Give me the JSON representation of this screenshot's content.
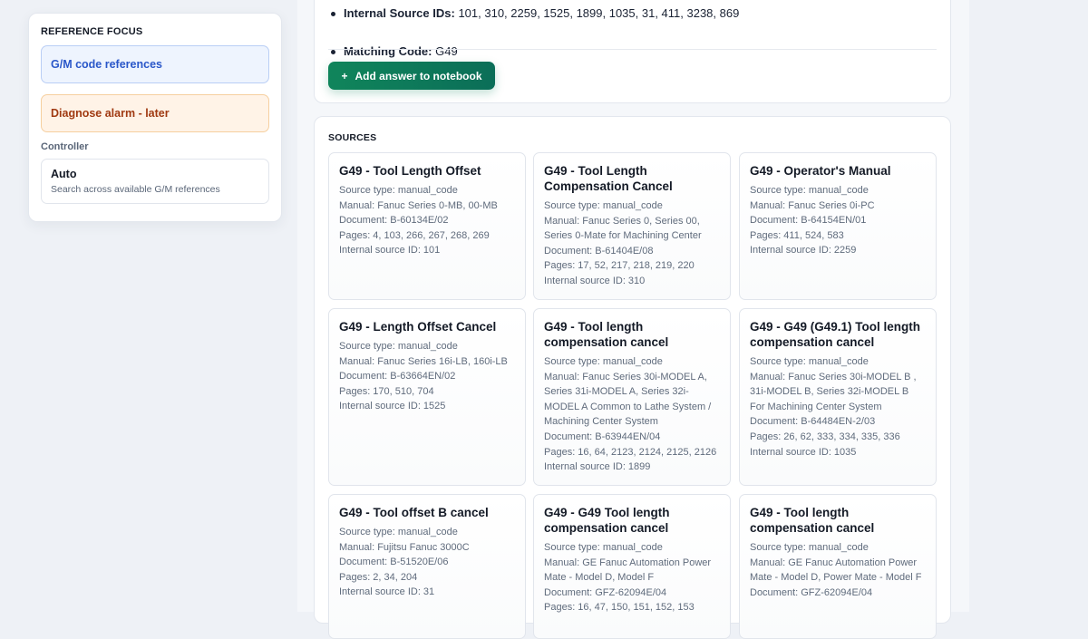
{
  "sidebar": {
    "title": "REFERENCE FOCUS",
    "options": [
      {
        "label": "G/M code references"
      },
      {
        "label": "Diagnose alarm - later"
      }
    ],
    "controller_label": "Controller",
    "controller": {
      "value": "Auto",
      "hint": "Search across available G/M references"
    }
  },
  "answer": {
    "items": [
      {
        "key": "Internal Source IDs",
        "value": "101, 310, 2259, 1525, 1899, 1035, 31, 411, 3238, 869"
      },
      {
        "key": "Matching Code",
        "value": "G49"
      }
    ],
    "add_button": "Add answer to notebook",
    "add_icon": "+"
  },
  "sources": {
    "title": "SOURCES",
    "items": [
      {
        "title": "G49 - Tool Length Offset",
        "lines": [
          "Source type: manual_code",
          "Manual: Fanuc Series 0-MB, 00-MB",
          "Document: B-60134E/02",
          "Pages: 4, 103, 266, 267, 268, 269",
          "Internal source ID: 101"
        ]
      },
      {
        "title": "G49 - Tool Length Compensation Cancel",
        "lines": [
          "Source type: manual_code",
          "Manual: Fanuc Series 0, Series 00, Series 0-Mate for Machining Center",
          "Document: B-61404E/08",
          "Pages: 17, 52, 217, 218, 219, 220",
          "Internal source ID: 310"
        ]
      },
      {
        "title": "G49 - Operator's Manual",
        "lines": [
          "Source type: manual_code",
          "Manual: Fanuc Series 0i-PC",
          "Document: B-64154EN/01",
          "Pages: 411, 524, 583",
          "Internal source ID: 2259"
        ]
      },
      {
        "title": "G49 - Length Offset Cancel",
        "lines": [
          "Source type: manual_code",
          "Manual: Fanuc Series 16i-LB, 160i-LB",
          "Document: B-63664EN/02",
          "Pages: 170, 510, 704",
          "Internal source ID: 1525"
        ]
      },
      {
        "title": "G49 - Tool length compensation cancel",
        "lines": [
          "Source type: manual_code",
          "Manual: Fanuc Series 30i-MODEL A, Series 31i-MODEL A, Series 32i-MODEL A Common to Lathe System / Machining Center System",
          "Document: B-63944EN/04",
          "Pages: 16, 64, 2123, 2124, 2125, 2126",
          "Internal source ID: 1899"
        ]
      },
      {
        "title": "G49 - G49 (G49.1) Tool length compensation cancel",
        "lines": [
          "Source type: manual_code",
          "Manual: Fanuc Series 30i-MODEL B , 31i-MODEL B, Series 32i-MODEL B For Machining Center System",
          "Document: B-64484EN-2/03",
          "Pages: 26, 62, 333, 334, 335, 336",
          "Internal source ID: 1035"
        ]
      },
      {
        "title": "G49 - Tool offset B cancel",
        "lines": [
          "Source type: manual_code",
          "Manual: Fujitsu Fanuc 3000C",
          "Document: B-51520E/06",
          "Pages: 2, 34, 204",
          "Internal source ID: 31"
        ]
      },
      {
        "title": "G49 - G49 Tool length compensation cancel",
        "lines": [
          "Source type: manual_code",
          "Manual: GE Fanuc Automation Power Mate - Model D, Model F",
          "Document: GFZ-62094E/04",
          "Pages: 16, 47, 150, 151, 152, 153"
        ]
      },
      {
        "title": "G49 - Tool length compensation cancel",
        "lines": [
          "Source type: manual_code",
          "Manual: GE Fanuc Automation Power Mate - Model D, Power Mate - Model F",
          "Document: GFZ-62094E/04"
        ]
      }
    ]
  }
}
